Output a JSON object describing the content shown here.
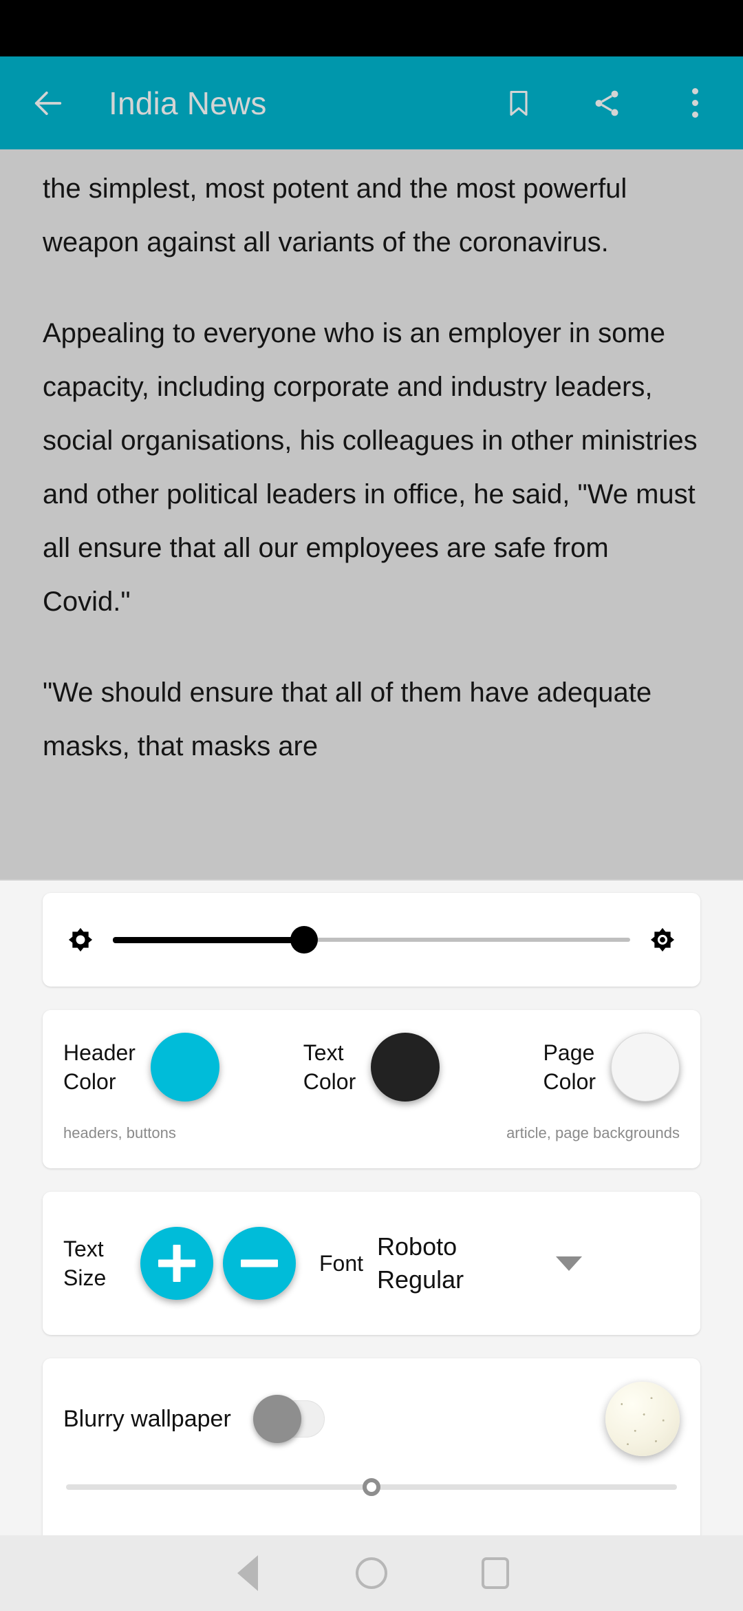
{
  "app_bar": {
    "title": "India News",
    "back_icon": "arrow-left-icon",
    "bookmark_icon": "bookmark-icon",
    "share_icon": "share-icon",
    "overflow_icon": "more-vertical-icon",
    "background_color": "#0097ac",
    "title_color": "#d4d4d4"
  },
  "article": {
    "background_color": "#c4c4c4",
    "text_color": "#141414",
    "paragraphs": [
      "the simplest, most potent and the most powerful weapon against all variants of the coronavirus.",
      "Appealing to everyone who is an employer in some capacity, including corporate and industry leaders, social organisations, his colleagues in other ministries and other political leaders in office, he said, \"We must all ensure that all our employees are safe from Covid.\"",
      "\"We should ensure that all of them have adequate masks, that masks are"
    ]
  },
  "settings": {
    "brightness": {
      "low_icon": "brightness-low-icon",
      "high_icon": "brightness-high-icon",
      "value_percent": 37
    },
    "colors": {
      "header": {
        "label_line1": "Header",
        "label_line2": "Color",
        "swatch_color": "#00bcd9",
        "hint": "headers, buttons"
      },
      "text": {
        "label_line1": "Text",
        "label_line2": "Color",
        "swatch_color": "#222222",
        "hint": ""
      },
      "page": {
        "label_line1": "Page",
        "label_line2": "Color",
        "swatch_color": "#f5f5f5",
        "hint": "article, page backgrounds"
      }
    },
    "text_size": {
      "label_line1": "Text",
      "label_line2": "Size",
      "increase_icon": "plus-icon",
      "decrease_icon": "minus-icon",
      "button_color": "#00bcd9"
    },
    "font": {
      "label": "Font",
      "value_line1": "Roboto",
      "value_line2": "Regular",
      "dropdown_icon": "chevron-down-icon"
    },
    "wallpaper": {
      "label": "Blurry wallpaper",
      "toggle_state": "off",
      "preview_icon": "wallpaper-preview",
      "blur_value_percent": 50
    }
  },
  "nav_bar": {
    "back_icon": "nav-back-icon",
    "home_icon": "nav-home-icon",
    "recents_icon": "nav-recents-icon",
    "background_color": "#eaeaea"
  }
}
